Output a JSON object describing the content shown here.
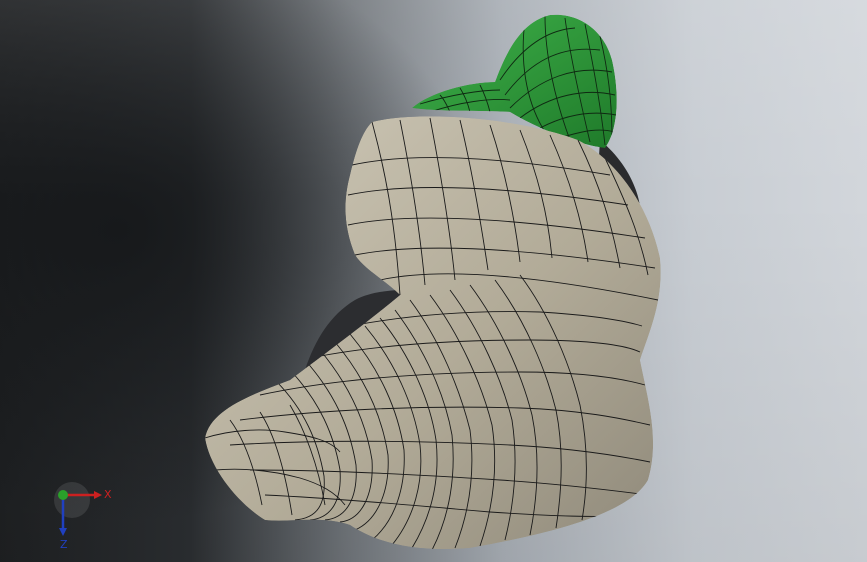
{
  "viewport": {
    "name": "3d-graphics-area"
  },
  "triad": {
    "x_label": "X",
    "z_label": "Z",
    "colors": {
      "x": "#cc2020",
      "y": "#2aa02a",
      "z": "#2040c0"
    }
  },
  "model": {
    "body_color": "#b7b09e",
    "accent_color": "#2e9a3a",
    "edge_color": "#1a1a1a",
    "shadow_color": "#2a2b2d"
  }
}
